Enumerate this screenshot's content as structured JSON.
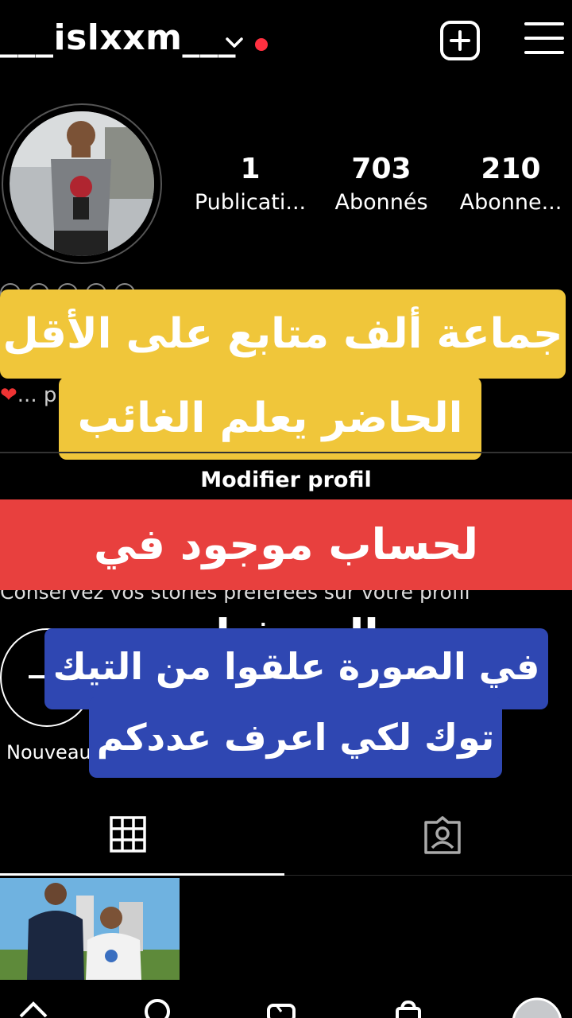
{
  "header": {
    "username": "___islxxm___",
    "icons": [
      "chevron-down-icon",
      "notification-dot-icon",
      "create-plus-icon",
      "menu-hamburger-icon"
    ]
  },
  "profile": {
    "stats": [
      {
        "value": "1",
        "label": "Publicati..."
      },
      {
        "value": "703",
        "label": "Abonnés"
      },
      {
        "value": "210",
        "label": "Abonne..."
      }
    ],
    "bio_fragment": "... p",
    "edit_profile_label": "Modifier profil",
    "stories_hint": "Conservez vos stories préférées sur votre profil",
    "new_highlight_label": "Nouveau"
  },
  "overlays": {
    "yellow_line1": "جماعة ألف متابع على الأقل",
    "yellow_line2": "الحاضر يعلم الغائب",
    "red_line": "لحساب موجود في البروفيل",
    "blue_line1": "في الصورة علقوا من التيك",
    "blue_line2": "توك لكي اعرف عددكم"
  },
  "colors": {
    "yellow": "#f0c63a",
    "red": "#e8403e",
    "blue": "#2f47b2",
    "notification": "#ff3040"
  }
}
